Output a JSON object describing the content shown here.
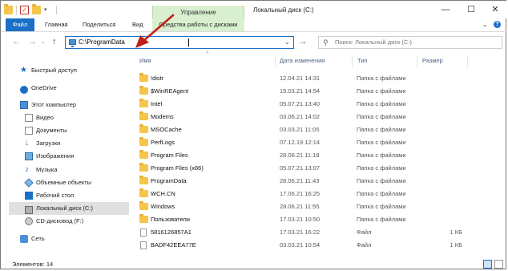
{
  "titlebar": {
    "contextual_tab": "Управление",
    "window_title": "Локальный диск (C:)",
    "minimize": "—",
    "maximize": "☐",
    "close": "✕"
  },
  "ribbon": {
    "tabs": [
      "Файл",
      "Главная",
      "Поделиться",
      "Вид",
      "Средства работы с дисками"
    ]
  },
  "nav": {
    "address": "C:\\ProgramData",
    "search_placeholder": "Поиск: Локальный диск (C:)"
  },
  "sidebar": {
    "items": [
      {
        "label": "Быстрый доступ",
        "icon": "star-icon"
      },
      {
        "label": "OneDrive",
        "icon": "cloud-icon"
      },
      {
        "label": "Этот компьютер",
        "icon": "computer-icon"
      },
      {
        "label": "Видео",
        "icon": "video-icon"
      },
      {
        "label": "Документы",
        "icon": "documents-icon"
      },
      {
        "label": "Загрузки",
        "icon": "downloads-icon"
      },
      {
        "label": "Изображения",
        "icon": "pictures-icon"
      },
      {
        "label": "Музыка",
        "icon": "music-icon"
      },
      {
        "label": "Объемные объекты",
        "icon": "3d-objects-icon"
      },
      {
        "label": "Рабочий стол",
        "icon": "desktop-icon"
      },
      {
        "label": "Локальный диск (C:)",
        "icon": "drive-icon"
      },
      {
        "label": "CD-дисковод (F:)",
        "icon": "cd-drive-icon"
      },
      {
        "label": "Сеть",
        "icon": "network-icon"
      }
    ]
  },
  "columns": {
    "name": "Имя",
    "date": "Дата изменения",
    "type": "Тип",
    "size": "Размер"
  },
  "files": [
    {
      "name": "!distr",
      "date": "12.04.21 14:31",
      "type": "Папка с файлами",
      "size": "",
      "kind": "folder"
    },
    {
      "name": "$WinREAgent",
      "date": "15.03.21 14:54",
      "type": "Папка с файлами",
      "size": "",
      "kind": "folder"
    },
    {
      "name": "Intel",
      "date": "05.07.21 13:40",
      "type": "Папка с файлами",
      "size": "",
      "kind": "folder"
    },
    {
      "name": "Modems",
      "date": "03.06.21 14:02",
      "type": "Папка с файлами",
      "size": "",
      "kind": "folder"
    },
    {
      "name": "MSOCache",
      "date": "03.03.21 11:05",
      "type": "Папка с файлами",
      "size": "",
      "kind": "folder"
    },
    {
      "name": "PerfLogs",
      "date": "07.12.19 12:14",
      "type": "Папка с файлами",
      "size": "",
      "kind": "folder"
    },
    {
      "name": "Program Files",
      "date": "28.06.21 11:18",
      "type": "Папка с файлами",
      "size": "",
      "kind": "folder"
    },
    {
      "name": "Program Files (x86)",
      "date": "05.07.21 13:07",
      "type": "Папка с файлами",
      "size": "",
      "kind": "folder"
    },
    {
      "name": "ProgramData",
      "date": "28.06.21 11:43",
      "type": "Папка с файлами",
      "size": "",
      "kind": "folder"
    },
    {
      "name": "WCH.CN",
      "date": "17.06.21 16:25",
      "type": "Папка с файлами",
      "size": "",
      "kind": "folder"
    },
    {
      "name": "Windows",
      "date": "28.06.21 11:55",
      "type": "Папка с файлами",
      "size": "",
      "kind": "folder"
    },
    {
      "name": "Пользователи",
      "date": "17.03.21 10:50",
      "type": "Папка с файлами",
      "size": "",
      "kind": "folder"
    },
    {
      "name": "5816126857A1",
      "date": "17.03.21 16:22",
      "type": "Файл",
      "size": "1 КБ",
      "kind": "file"
    },
    {
      "name": "BADF42EEA77E",
      "date": "03.03.21 10:54",
      "type": "Файл",
      "size": "1 КБ",
      "kind": "file"
    }
  ],
  "status": {
    "count": "Элементов: 14"
  },
  "colors": {
    "accent": "#1a6fc7",
    "contextual": "#d9f0d0",
    "annotation_arrow": "#c0201a"
  }
}
